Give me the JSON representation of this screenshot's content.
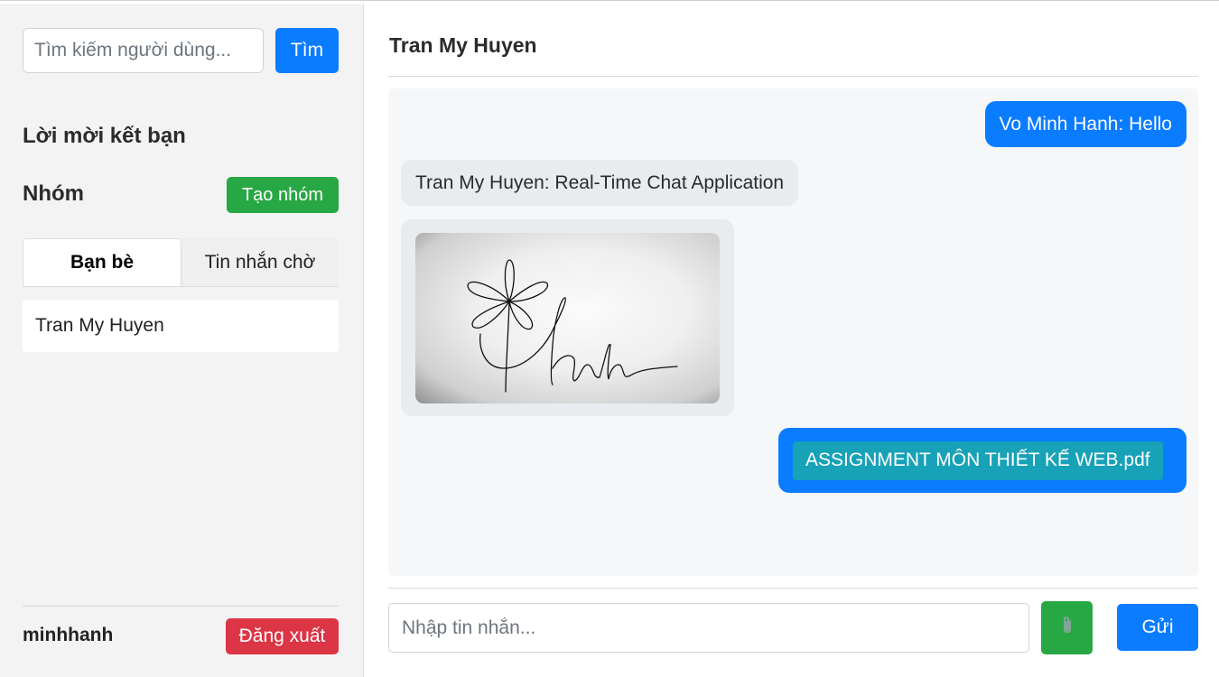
{
  "sidebar": {
    "search": {
      "placeholder": "Tìm kiếm người dùng...",
      "button_label": "Tìm"
    },
    "friend_requests_title": "Lời mời kết bạn",
    "groups": {
      "title": "Nhóm",
      "create_label": "Tạo nhóm"
    },
    "tabs": [
      {
        "label": "Bạn bè",
        "active": true
      },
      {
        "label": "Tin nhắn chờ",
        "active": false
      }
    ],
    "friends": [
      {
        "name": "Tran My Huyen"
      }
    ],
    "footer": {
      "username": "minhhanh",
      "logout_label": "Đăng xuất"
    }
  },
  "chat": {
    "title": "Tran My Huyen",
    "messages": [
      {
        "direction": "outgoing",
        "type": "text",
        "text": "Vo Minh Hanh: Hello"
      },
      {
        "direction": "incoming",
        "type": "text",
        "text": "Tran My Huyen: Real-Time Chat Application"
      },
      {
        "direction": "incoming",
        "type": "image",
        "image_content": "handwritten signature 'Thanh' with flower drawing",
        "signature_text": "Thanh"
      },
      {
        "direction": "outgoing",
        "type": "file",
        "filename": "ASSIGNMENT MÔN THIẾT KẾ WEB.pdf"
      }
    ],
    "composer": {
      "placeholder": "Nhập tin nhắn...",
      "attach_icon": "paperclip-icon",
      "send_label": "Gửi"
    }
  },
  "colors": {
    "primary": "#0a7cff",
    "success": "#28a745",
    "danger": "#dc3545",
    "file_chip": "#17a2b8",
    "sidebar_bg": "#f3f3f3",
    "incoming_bubble": "#e9ecef"
  }
}
